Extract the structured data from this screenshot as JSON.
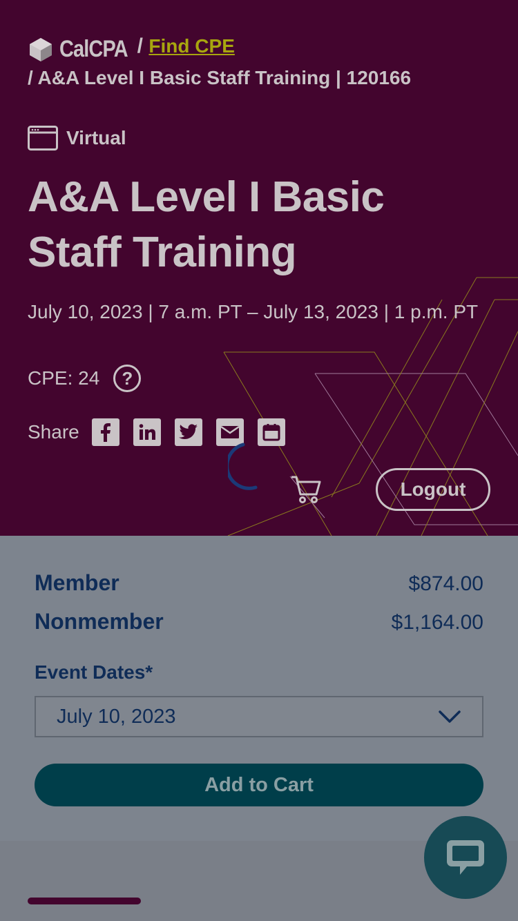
{
  "breadcrumb": {
    "brand": "CalCPA",
    "separator": "/",
    "link": "Find CPE",
    "current": "/ A&A Level I Basic Staff Training | 120166"
  },
  "event": {
    "format": "Virtual",
    "title": "A&A Level I Basic Staff Training",
    "dates": "July 10, 2023 | 7 a.m. PT – July 13, 2023 | 1 p.m. PT",
    "cpe": "CPE: 24",
    "help_glyph": "?"
  },
  "share": {
    "label": "Share",
    "buttons": [
      {
        "name": "facebook-icon"
      },
      {
        "name": "linkedin-icon"
      },
      {
        "name": "twitter-icon"
      },
      {
        "name": "email-icon"
      },
      {
        "name": "calendar-icon"
      }
    ]
  },
  "header": {
    "logout": "Logout"
  },
  "pricing": {
    "member_label": "Member",
    "member_price": "$874.00",
    "nonmember_label": "Nonmember",
    "nonmember_price": "$1,164.00"
  },
  "registration": {
    "dates_label": "Event Dates*",
    "selected_date": "July 10, 2023",
    "add_to_cart": "Add to Cart"
  },
  "colors": {
    "hero_bg": "#43052e",
    "text_navy": "#0f2c57",
    "button_teal": "#003e4a",
    "link_olive": "#a8a60f"
  }
}
